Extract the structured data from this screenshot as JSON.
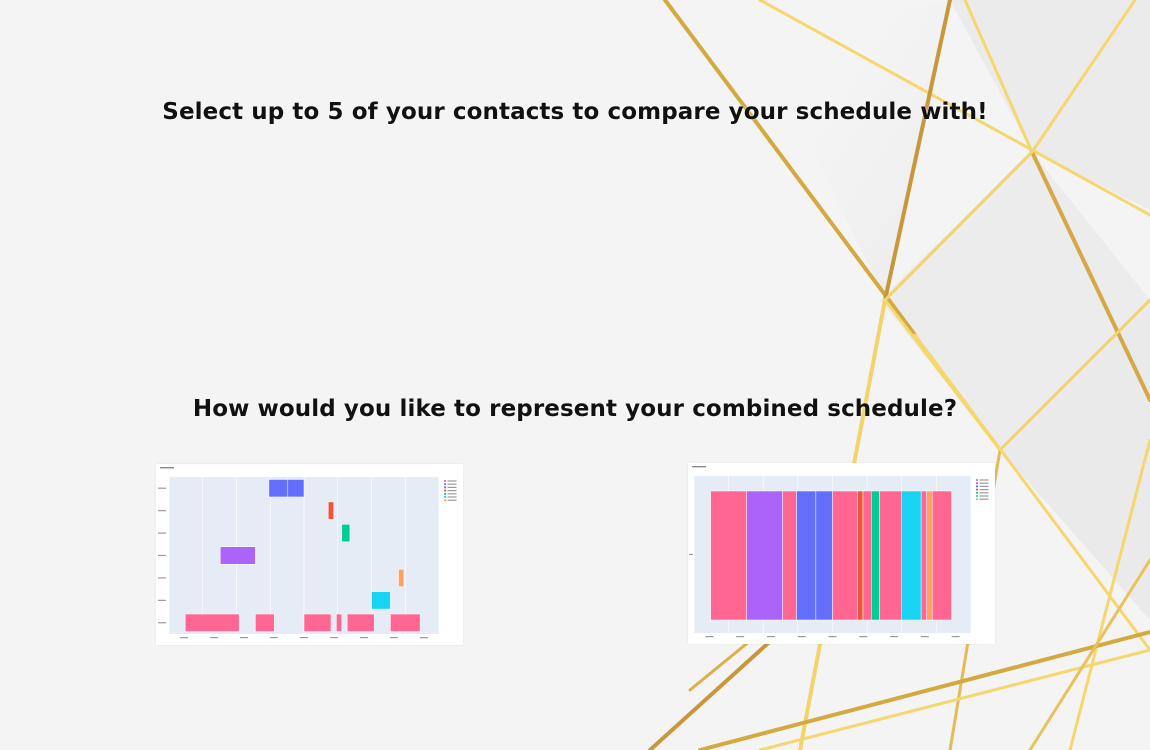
{
  "headings": {
    "contacts_prompt": "Select up to 5 of your contacts to compare your schedule with!",
    "representation_prompt": "How would you like to represent your combined schedule?"
  },
  "colors": {
    "background": "#f4f4f4",
    "gold_light": "#f5d76e",
    "gold_dark": "#c9973a",
    "plot_bg": "#e5ecf6",
    "series": [
      "#ff6692",
      "#ab63fa",
      "#636efa",
      "#ef553b",
      "#00cc96",
      "#19d3f3",
      "#ffa15a"
    ]
  },
  "chart_data": [
    {
      "type": "bar",
      "orientation": "horizontal-timeline",
      "title": "",
      "rows": [
        "",
        "",
        "",
        "",
        "",
        "",
        ""
      ],
      "legend_entries": [
        "",
        "",
        "",
        "",
        "",
        "",
        ""
      ],
      "legend_placement": "right",
      "x_range": [
        0,
        100
      ],
      "bars": [
        {
          "row": 0,
          "start": 6,
          "end": 26,
          "color": 0
        },
        {
          "row": 0,
          "start": 32,
          "end": 39,
          "color": 0
        },
        {
          "row": 0,
          "start": 50,
          "end": 60,
          "color": 0
        },
        {
          "row": 0,
          "start": 62,
          "end": 64,
          "color": 0
        },
        {
          "row": 0,
          "start": 66,
          "end": 76,
          "color": 0
        },
        {
          "row": 0,
          "start": 82,
          "end": 93,
          "color": 0
        },
        {
          "row": 1,
          "start": 75,
          "end": 82,
          "color": 5
        },
        {
          "row": 2,
          "start": 85,
          "end": 87,
          "color": 6
        },
        {
          "row": 3,
          "start": 19,
          "end": 32,
          "color": 1
        },
        {
          "row": 4,
          "start": 64,
          "end": 67,
          "color": 4
        },
        {
          "row": 5,
          "start": 59,
          "end": 61,
          "color": 3
        },
        {
          "row": 6,
          "start": 37,
          "end": 44,
          "color": 2
        },
        {
          "row": 6,
          "start": 44,
          "end": 50,
          "color": 2
        }
      ],
      "grid": true
    },
    {
      "type": "bar",
      "orientation": "stacked-horizontal",
      "title": "",
      "legend_entries": [
        "",
        "",
        "",
        "",
        "",
        "",
        ""
      ],
      "legend_placement": "right",
      "x_range": [
        0,
        100
      ],
      "segments": [
        {
          "start": 6,
          "end": 19,
          "color": 0
        },
        {
          "start": 19,
          "end": 32,
          "color": 1
        },
        {
          "start": 32,
          "end": 37,
          "color": 0
        },
        {
          "start": 37,
          "end": 44,
          "color": 2
        },
        {
          "start": 44,
          "end": 50,
          "color": 2
        },
        {
          "start": 50,
          "end": 59,
          "color": 0
        },
        {
          "start": 59,
          "end": 61,
          "color": 3
        },
        {
          "start": 61,
          "end": 64,
          "color": 0
        },
        {
          "start": 64,
          "end": 67,
          "color": 4
        },
        {
          "start": 67,
          "end": 75,
          "color": 0
        },
        {
          "start": 75,
          "end": 82,
          "color": 5
        },
        {
          "start": 82,
          "end": 84,
          "color": 0
        },
        {
          "start": 84,
          "end": 86,
          "color": 6
        },
        {
          "start": 86,
          "end": 93,
          "color": 0
        }
      ],
      "grid": true
    }
  ]
}
